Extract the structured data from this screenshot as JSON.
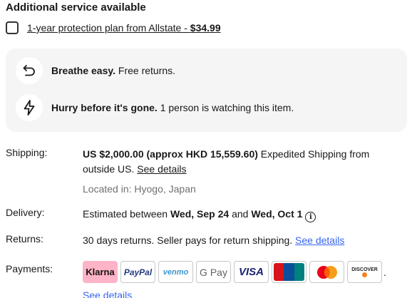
{
  "addons": {
    "title": "Additional service available",
    "plan_label": "1-year protection plan from Allstate - ",
    "plan_price": "$34.99"
  },
  "highlights": [
    {
      "icon": "return-arrow-icon",
      "bold": "Breathe easy.",
      "text": " Free returns."
    },
    {
      "icon": "lightning-icon",
      "bold": "Hurry before it's gone.",
      "text": " 1 person is watching this item."
    }
  ],
  "shipping": {
    "label": "Shipping:",
    "price": "US $2,000.00 (approx HKD 15,559.60)",
    "desc": " Expedited Shipping from outside US. ",
    "link": "See details",
    "location": "Located in: Hyogo, Japan"
  },
  "delivery": {
    "label": "Delivery:",
    "prefix": "Estimated between ",
    "start": "Wed, Sep 24",
    "middle": " and ",
    "end": "Wed, Oct 1",
    "info_icon": "i"
  },
  "returns": {
    "label": "Returns:",
    "text": "30 days returns. Seller pays for return shipping. ",
    "link": "See details"
  },
  "payments": {
    "label": "Payments:",
    "methods": [
      "Klarna",
      "PayPal",
      "venmo",
      "G Pay",
      "VISA",
      "UnionPay",
      "Mastercard",
      "DISCOVER"
    ],
    "trailing": ".",
    "link": "See details"
  },
  "colors": {
    "link_blue": "#3665f3",
    "info_bg": "#f5f5f5",
    "klarna_pink": "#ffb3c7"
  }
}
